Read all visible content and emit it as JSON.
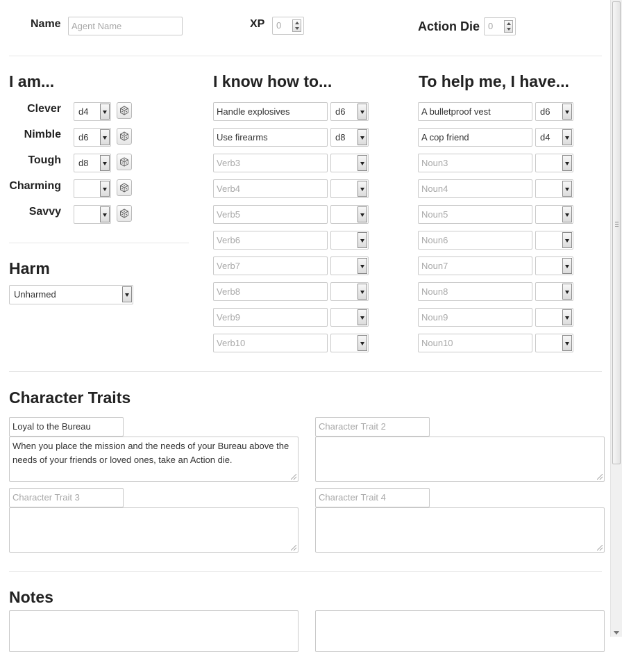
{
  "header": {
    "name_label": "Name",
    "name_placeholder": "Agent Name",
    "xp_label": "XP",
    "xp_value": "0",
    "action_die_label": "Action Die",
    "action_die_value": "0"
  },
  "attributes": {
    "title": "I am...",
    "items": [
      {
        "label": "Clever",
        "die": "d4"
      },
      {
        "label": "Nimble",
        "die": "d6"
      },
      {
        "label": "Tough",
        "die": "d8"
      },
      {
        "label": "Charming",
        "die": ""
      },
      {
        "label": "Savvy",
        "die": ""
      }
    ]
  },
  "harm": {
    "title": "Harm",
    "value": "Unharmed"
  },
  "skills": {
    "title": "I know how to...",
    "items": [
      {
        "value": "Handle explosives",
        "placeholder": "",
        "die": "d6"
      },
      {
        "value": "Use firearms",
        "placeholder": "",
        "die": "d8"
      },
      {
        "value": "",
        "placeholder": "Verb3",
        "die": ""
      },
      {
        "value": "",
        "placeholder": "Verb4",
        "die": ""
      },
      {
        "value": "",
        "placeholder": "Verb5",
        "die": ""
      },
      {
        "value": "",
        "placeholder": "Verb6",
        "die": ""
      },
      {
        "value": "",
        "placeholder": "Verb7",
        "die": ""
      },
      {
        "value": "",
        "placeholder": "Verb8",
        "die": ""
      },
      {
        "value": "",
        "placeholder": "Verb9",
        "die": ""
      },
      {
        "value": "",
        "placeholder": "Verb10",
        "die": ""
      }
    ]
  },
  "resources": {
    "title": "To help me, I have...",
    "items": [
      {
        "value": "A bulletproof vest",
        "placeholder": "",
        "die": "d6"
      },
      {
        "value": "A cop friend",
        "placeholder": "",
        "die": "d4"
      },
      {
        "value": "",
        "placeholder": "Noun3",
        "die": ""
      },
      {
        "value": "",
        "placeholder": "Noun4",
        "die": ""
      },
      {
        "value": "",
        "placeholder": "Noun5",
        "die": ""
      },
      {
        "value": "",
        "placeholder": "Noun6",
        "die": ""
      },
      {
        "value": "",
        "placeholder": "Noun7",
        "die": ""
      },
      {
        "value": "",
        "placeholder": "Noun8",
        "die": ""
      },
      {
        "value": "",
        "placeholder": "Noun9",
        "die": ""
      },
      {
        "value": "",
        "placeholder": "Noun10",
        "die": ""
      }
    ]
  },
  "traits": {
    "title": "Character Traits",
    "items": [
      {
        "name": "Loyal to the Bureau",
        "placeholder": "",
        "description": "When you place the mission and the needs of your Bureau above the needs of your friends or loved ones, take an Action die."
      },
      {
        "name": "",
        "placeholder": "Character Trait 2",
        "description": ""
      },
      {
        "name": "",
        "placeholder": "Character Trait 3",
        "description": ""
      },
      {
        "name": "",
        "placeholder": "Character Trait 4",
        "description": ""
      }
    ]
  },
  "notes": {
    "title": "Notes",
    "left": "",
    "right": ""
  },
  "icons": {
    "dice_roll": "dice-icon",
    "resize": "resize-grip-icon"
  }
}
